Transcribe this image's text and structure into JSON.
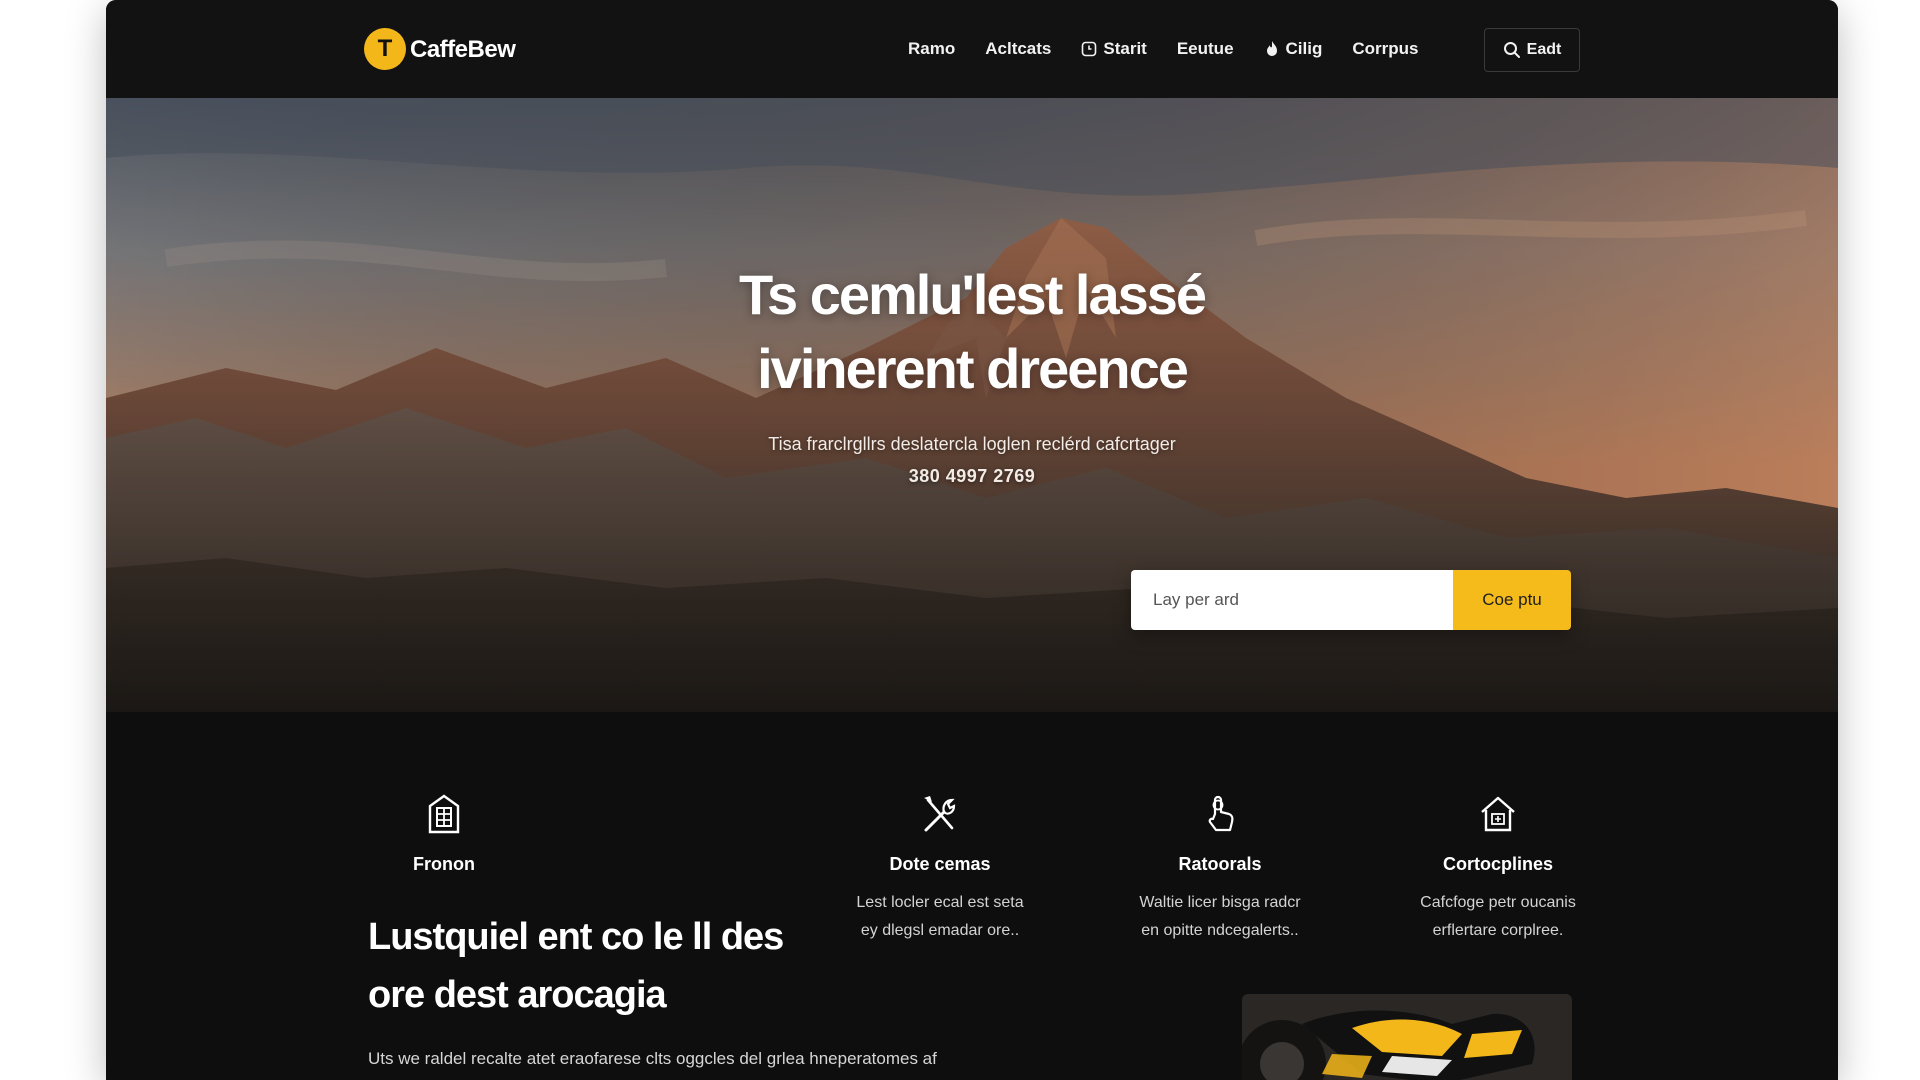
{
  "brand": {
    "logo_letter": "T",
    "name": "CaffeBew",
    "tagline": "",
    "accent_color": "#f5bb1b"
  },
  "nav": {
    "items": [
      {
        "label": "Ramo",
        "icon": ""
      },
      {
        "label": "Acltcats",
        "icon": ""
      },
      {
        "label": "Starit",
        "icon": "clock-icon"
      },
      {
        "label": "Eeutue",
        "icon": ""
      },
      {
        "label": "Cilig",
        "icon": "fire-icon"
      },
      {
        "label": "Corrpus",
        "icon": ""
      }
    ],
    "search_label": "Eadt",
    "search_icon": "search-icon"
  },
  "hero": {
    "title_line1": "Ts cemlu'lest lassé",
    "title_line2": "ivinerent dreence",
    "subtitle": "Tisa frarclrgllrs deslatercla loglen reclérd cafcrtager",
    "phone": "380 4997 2769",
    "subscribe_placeholder": "Lay per ard",
    "subscribe_button": "Coe ptu"
  },
  "features": [
    {
      "icon": "building-icon",
      "title": "Fronon",
      "desc_line1": "",
      "desc_line2": ""
    },
    {
      "icon": "tools-icon",
      "title": "Dote cemas",
      "desc_line1": "Lest locler ecal est seta",
      "desc_line2": "ey dlegsl emadar ore.."
    },
    {
      "icon": "hand-pointer-icon",
      "title": "Ratoorals",
      "desc_line1": "Waltie licer bisga radcr",
      "desc_line2": "en opitte ndcegalerts.."
    },
    {
      "icon": "home-icon",
      "title": "Cortocplines",
      "desc_line1": "Cafcfoge petr oucanis",
      "desc_line2": "erflertare corplree."
    }
  ],
  "section": {
    "heading_line1": "Lustquiel ent co le ll des",
    "heading_line2": "ore dest arocagia",
    "body": "Uts we raldel recalte atet eraofarese clts oggcles del grlea hneperatomes af"
  }
}
